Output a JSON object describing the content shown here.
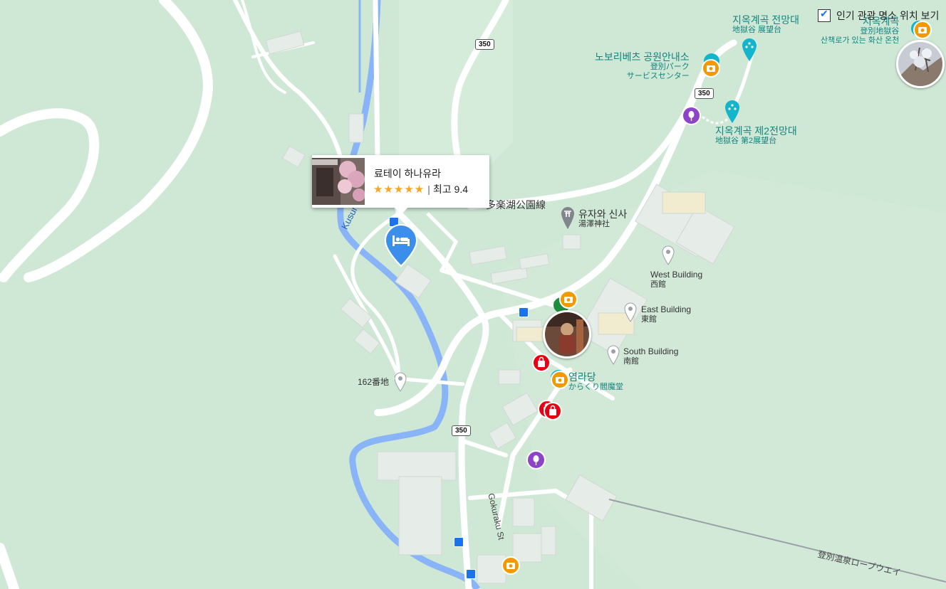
{
  "hotel": {
    "name": "료테이 하나유라",
    "rating_label": "최고 9.4",
    "stars": "★★★★★"
  },
  "toggle_label": "인기 관광 명소 위치 보기",
  "labels": {
    "jigoku_obs_ko": "지옥계곡 전망대",
    "jigoku_obs_ja": "地獄谷 展望台",
    "jigoku_ko": "지옥계곡",
    "jigoku_ja": "登別地獄谷",
    "jigoku_sub": "산책로가 있는 화산 온천",
    "park_center_ko": "노보리베츠 공원안내소",
    "park_center_ja1": "登別パーク",
    "park_center_ja2": "サービスセンター",
    "obs2_ko": "지옥계곡 제2전망대",
    "obs2_ja": "地獄谷 第2展望台",
    "park_line": "多楽湖公園線",
    "shrine_ko": "유자와 신사",
    "shrine_ja": "湯澤神社",
    "west_en": "West Building",
    "west_ja": "西館",
    "east_en": "East Building",
    "east_ja": "東館",
    "south_en": "South Building",
    "south_ja": "南館",
    "enmado_ko": "염라당",
    "enmado_ja": "からくり閻魔堂",
    "banchi": "162番地",
    "river": "Kusuri-Betsu River",
    "gokuraku": "Gokuraku St",
    "ropeway": "登別温泉ロープウエイ"
  },
  "routes": [
    "350",
    "350",
    "350"
  ],
  "colors": {
    "map_bg": "#cfe8d6",
    "hotel_pin": "#3b8eea",
    "poi_teal": "#12b5cb",
    "photo_orange": "#f29900",
    "shop_red": "#e60012",
    "purple": "#8e44c9"
  }
}
